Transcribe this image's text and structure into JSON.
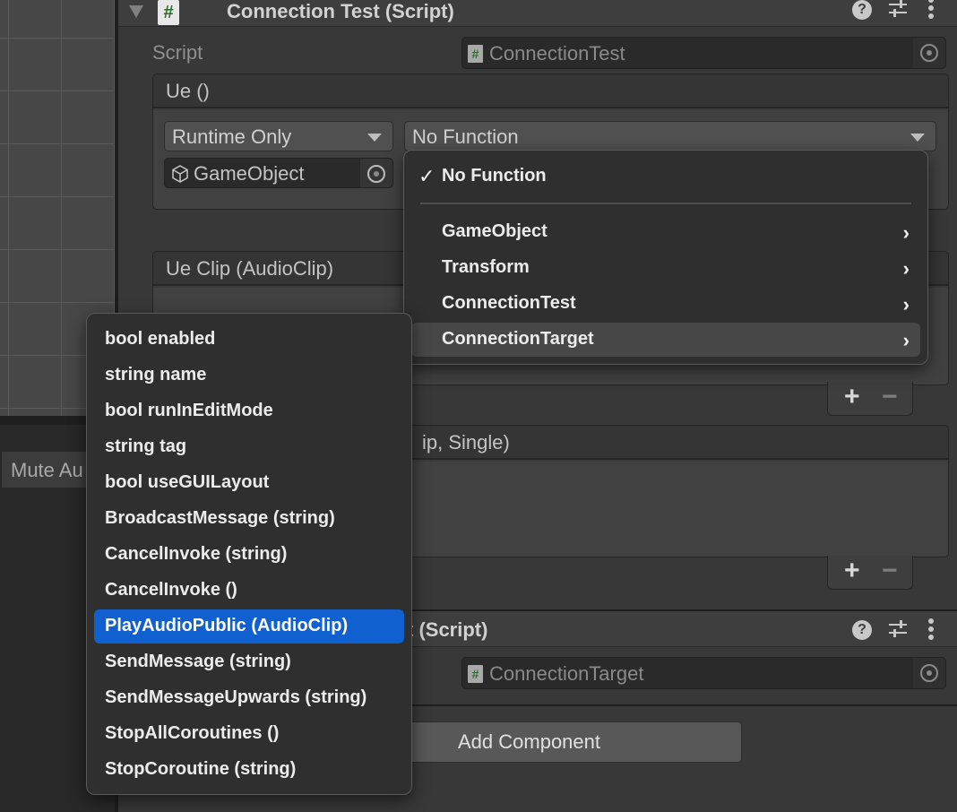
{
  "left_panel": {
    "mute_button_label": "Mute Au"
  },
  "connection_test": {
    "title": "Connection Test (Script)",
    "script_label": "Script",
    "script_value": "ConnectionTest",
    "event_ue": {
      "header": "Ue ()",
      "call_state": "Runtime Only",
      "target_object": "GameObject",
      "function": "No Function"
    },
    "event_ue_clip": {
      "header": "Ue Clip (AudioClip)"
    },
    "event_third": {
      "header_visible_fragment": "ip, Single)"
    },
    "add_symbol": "+",
    "remove_symbol": "−"
  },
  "connection_target": {
    "title_visible_fragment": "t (Script)",
    "script_value": "ConnectionTarget"
  },
  "add_component_label": "Add Component",
  "header_icons": {
    "help": "?",
    "presets": "⇋",
    "more": "⋮"
  },
  "function_menu": {
    "items": [
      {
        "label": "No Function",
        "checked": true,
        "check_glyph": "✓"
      },
      {
        "label": "GameObject",
        "submenu": true
      },
      {
        "label": "Transform",
        "submenu": true
      },
      {
        "label": "ConnectionTest",
        "submenu": true
      },
      {
        "label": "ConnectionTarget",
        "submenu": true,
        "hovered": true
      }
    ],
    "chevron_glyph": "›"
  },
  "submenu": {
    "items": [
      {
        "label": "bool enabled"
      },
      {
        "label": "string name"
      },
      {
        "label": "bool runInEditMode"
      },
      {
        "label": "string tag"
      },
      {
        "label": "bool useGUILayout"
      },
      {
        "label": "BroadcastMessage (string)"
      },
      {
        "label": "CancelInvoke (string)"
      },
      {
        "label": "CancelInvoke ()"
      },
      {
        "label": "PlayAudioPublic (AudioClip)",
        "selected": true
      },
      {
        "label": "SendMessage (string)"
      },
      {
        "label": "SendMessageUpwards (string)"
      },
      {
        "label": "StopAllCoroutines ()"
      },
      {
        "label": "StopCoroutine (string)"
      }
    ]
  },
  "colors": {
    "selection": "#1060d0",
    "script_icon_green": "#2e6b2e",
    "panel_bg": "#383838"
  }
}
